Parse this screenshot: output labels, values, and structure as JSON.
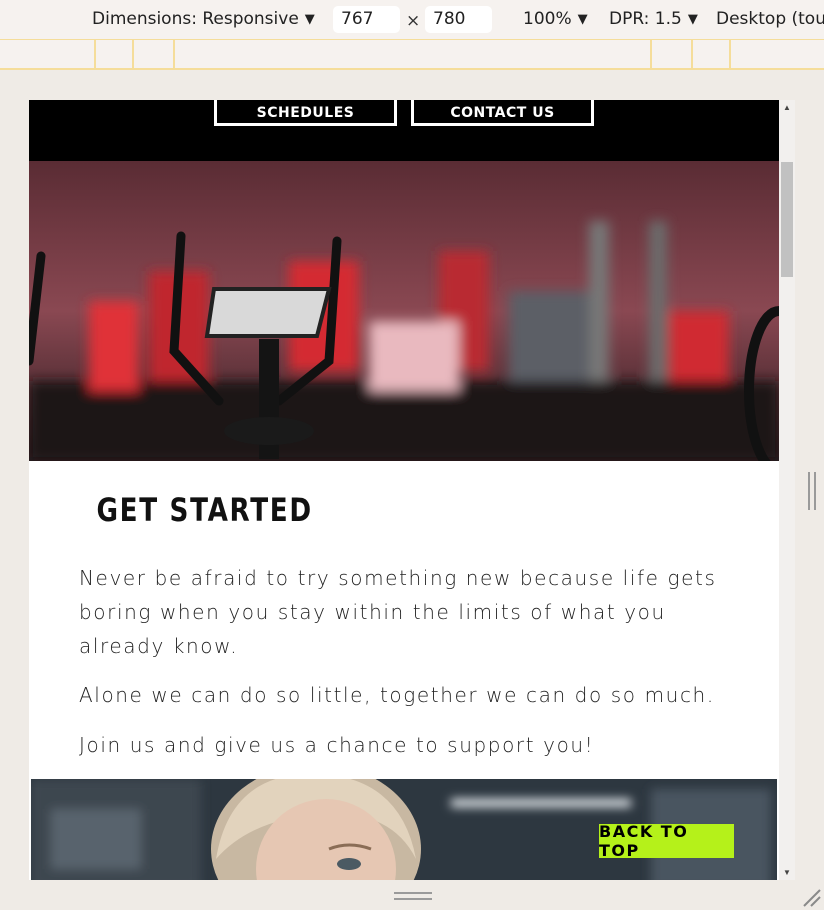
{
  "toolbar": {
    "dimensions_label": "Dimensions: Responsive",
    "width_value": "767",
    "times": "×",
    "height_value": "780",
    "zoom": "100%",
    "dpr": "DPR: 1.5",
    "device_mode": "Desktop (touc"
  },
  "page": {
    "nav": {
      "schedules": "SCHEDULES",
      "contact": "CONTACT US"
    },
    "section_title": "GET STARTED",
    "paragraphs": {
      "p1": "Never be afraid to try something new because life gets boring when you stay within the limits of what you already know.",
      "p2": "Alone we can do so little, together we can do so much.",
      "p3": "Join us and give us a chance to support you!"
    },
    "back_to_top": "BACK TO TOP"
  },
  "icons": [
    "caret-down-icon",
    "scroll-up-icon",
    "scroll-down-icon",
    "resize-handle-icon"
  ],
  "colors": {
    "accent": "#b5f11a",
    "nav_bg": "#000000",
    "media_query_bar": "#f5dd9a"
  }
}
